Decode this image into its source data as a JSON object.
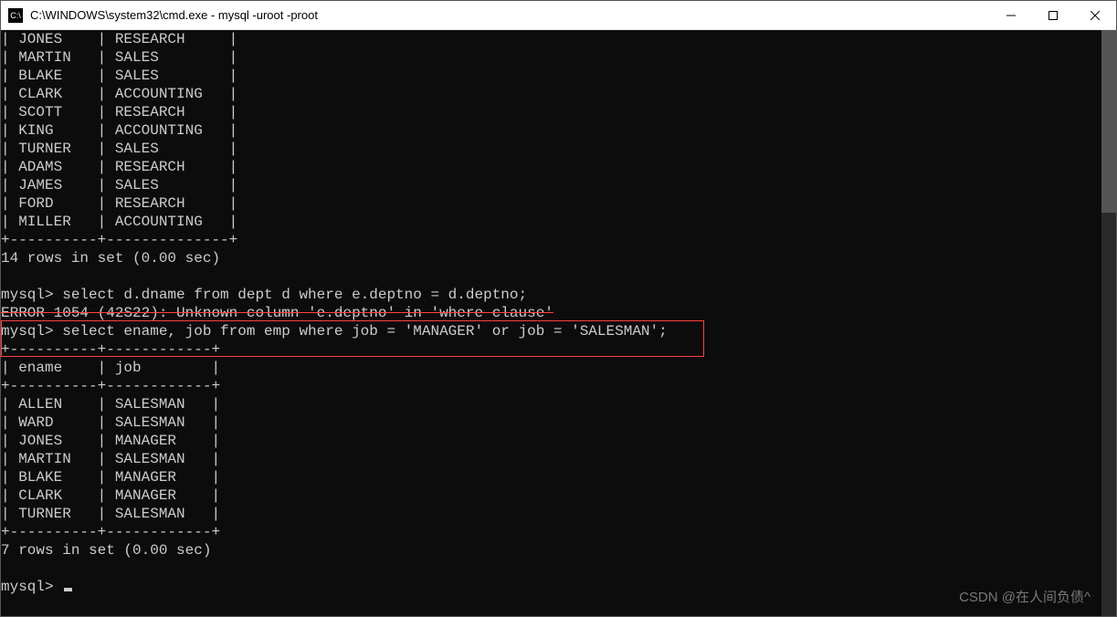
{
  "window": {
    "title": "C:\\WINDOWS\\system32\\cmd.exe - mysql  -uroot -proot"
  },
  "table1": {
    "rows": [
      {
        "ename": "JONES",
        "dname": "RESEARCH"
      },
      {
        "ename": "MARTIN",
        "dname": "SALES"
      },
      {
        "ename": "BLAKE",
        "dname": "SALES"
      },
      {
        "ename": "CLARK",
        "dname": "ACCOUNTING"
      },
      {
        "ename": "SCOTT",
        "dname": "RESEARCH"
      },
      {
        "ename": "KING",
        "dname": "ACCOUNTING"
      },
      {
        "ename": "TURNER",
        "dname": "SALES"
      },
      {
        "ename": "ADAMS",
        "dname": "RESEARCH"
      },
      {
        "ename": "JAMES",
        "dname": "SALES"
      },
      {
        "ename": "FORD",
        "dname": "RESEARCH"
      },
      {
        "ename": "MILLER",
        "dname": "ACCOUNTING"
      }
    ],
    "footer": "14 rows in set (0.00 sec)"
  },
  "lines": {
    "prompt1": "mysql> select d.dname from dept d where e.deptno = d.deptno;",
    "error": "ERROR 1054 (42S22): Unknown column 'e.deptno' in 'where clause'",
    "prompt2": "mysql> select ename, job from emp where job = 'MANAGER' or job = 'SALESMAN';"
  },
  "table2": {
    "header": {
      "col1": "ename",
      "col2": "job"
    },
    "rows": [
      {
        "ename": "ALLEN",
        "job": "SALESMAN"
      },
      {
        "ename": "WARD",
        "job": "SALESMAN"
      },
      {
        "ename": "JONES",
        "job": "MANAGER"
      },
      {
        "ename": "MARTIN",
        "job": "SALESMAN"
      },
      {
        "ename": "BLAKE",
        "job": "MANAGER"
      },
      {
        "ename": "CLARK",
        "job": "MANAGER"
      },
      {
        "ename": "TURNER",
        "job": "SALESMAN"
      }
    ],
    "footer": "7 rows in set (0.00 sec)"
  },
  "prompt3": "mysql> ",
  "watermark": "CSDN @在人间负债^"
}
